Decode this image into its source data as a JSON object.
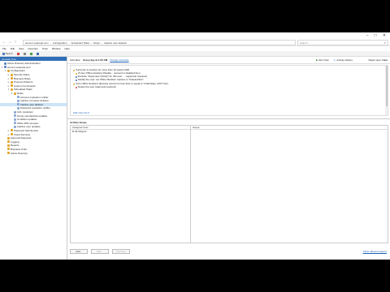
{
  "window": {
    "min_icon": "minimize-icon",
    "max_icon": "maximize-icon",
    "close_icon": "close-icon"
  },
  "address": {
    "crumbs": [
      "server1.example.com",
      "Configuration",
      "Scheduled Tasks",
      "Rules",
      "Inactive user deletion"
    ],
    "search_placeholder": "Search ..."
  },
  "menu": [
    "File",
    "Edit",
    "View",
    "Favorites",
    "Tools",
    "Window",
    "Help"
  ],
  "toolbar": {
    "new_label": "New"
  },
  "left_panel": {
    "header": "Console Tree",
    "tree": [
      {
        "label": "Active Directory Administration",
        "level": 0,
        "exp": "",
        "color": "#5b87c5"
      },
      {
        "label": "server1.example.com",
        "level": 0,
        "exp": "▾",
        "color": "#5b87c5"
      },
      {
        "label": "Configuration",
        "level": 1,
        "exp": "▾",
        "color": "#e0a72c"
      },
      {
        "label": "Security Roles",
        "level": 2,
        "exp": "▸",
        "color": "#e0a72c"
      },
      {
        "label": "Business Rules",
        "level": 2,
        "exp": "▸",
        "color": "#e0a72c"
      },
      {
        "label": "Property Patterns",
        "level": 2,
        "exp": "▸",
        "color": "#e0a72c"
      },
      {
        "label": "Custom Commands",
        "level": 2,
        "exp": "▸",
        "color": "#e0a72c"
      },
      {
        "label": "Scheduled Tasks",
        "level": 2,
        "exp": "▾",
        "color": "#e0a72c"
      },
      {
        "label": "Rules",
        "level": 3,
        "exp": "▾",
        "color": "#e0a72c"
      },
      {
        "label": "Account expiration notifier",
        "level": 4,
        "exp": "",
        "color": "#8aa9d6"
      },
      {
        "label": "Inactive computer deletion",
        "level": 4,
        "exp": "",
        "color": "#8aa9d6"
      },
      {
        "label": "Inactive user deletion",
        "level": 4,
        "exp": "",
        "color": "#8aa9d6",
        "selected": true
      },
      {
        "label": "Password expiration notifier",
        "level": 4,
        "exp": "",
        "color": "#8aa9d6"
      },
      {
        "label": "GAL resolution",
        "level": 3,
        "exp": "",
        "color": "#8aa9d6"
      },
      {
        "label": "Group membership updates",
        "level": 3,
        "exp": "",
        "color": "#8aa9d6"
      },
      {
        "label": "Condition updates",
        "level": 3,
        "exp": "",
        "color": "#8aa9d6"
      },
      {
        "label": "Office 365 Licenses",
        "level": 3,
        "exp": "",
        "color": "#8aa9d6"
      },
      {
        "label": "Inactive user updates",
        "level": 3,
        "exp": "",
        "color": "#8aa9d6"
      },
      {
        "label": "Password Self-Service",
        "level": 2,
        "exp": "▸",
        "color": "#e0a72c"
      },
      {
        "label": "Cloud Services",
        "level": 2,
        "exp": "▸",
        "color": "#e0a72c"
      },
      {
        "label": "Approval Requests",
        "level": 1,
        "exp": "",
        "color": "#e0a72c"
      },
      {
        "label": "Logging",
        "level": 1,
        "exp": "",
        "color": "#e0a72c"
      },
      {
        "label": "Reports",
        "level": 1,
        "exp": "",
        "color": "#e0a72c"
      },
      {
        "label": "Business Units",
        "level": 1,
        "exp": "",
        "color": "#e0a72c"
      },
      {
        "label": "Active Directory",
        "level": 1,
        "exp": "",
        "color": "#e0a72c"
      }
    ]
  },
  "content": {
    "schedule_label": "Schedule:",
    "schedule_value": "Every day at 1:00 AM",
    "schedule_link": "Change schedule",
    "run_now": "Run Now",
    "activity_history": "Activity History",
    "object_type_label": "Object type:",
    "object_type_value": "User",
    "rules": [
      "If account is inactive for more than 10 weeks AND",
      "If User Office Hoteliers Disable... account is disabled then",
      "Exclude: Supervisor (Notify? for this user: ... (approval required)",
      "Modify the user: set Office Manfied: Inactive to \"Deleted/Info\"",
      "If the Office Hoteliers (Ensure) account is less than or equal to \"Indefinitely, UPN\" then",
      "Delete the user (approval required)"
    ],
    "new_rule_link": "Add new rule ▾",
    "scope_title": "Activity Scope",
    "scope_col1": "Assigned Over",
    "scope_col2": "Scope",
    "scope_row1": "All Objects",
    "buttons": [
      "Add...",
      "Edit...",
      "Remove"
    ],
    "bottom_right": "Show affected objects"
  }
}
